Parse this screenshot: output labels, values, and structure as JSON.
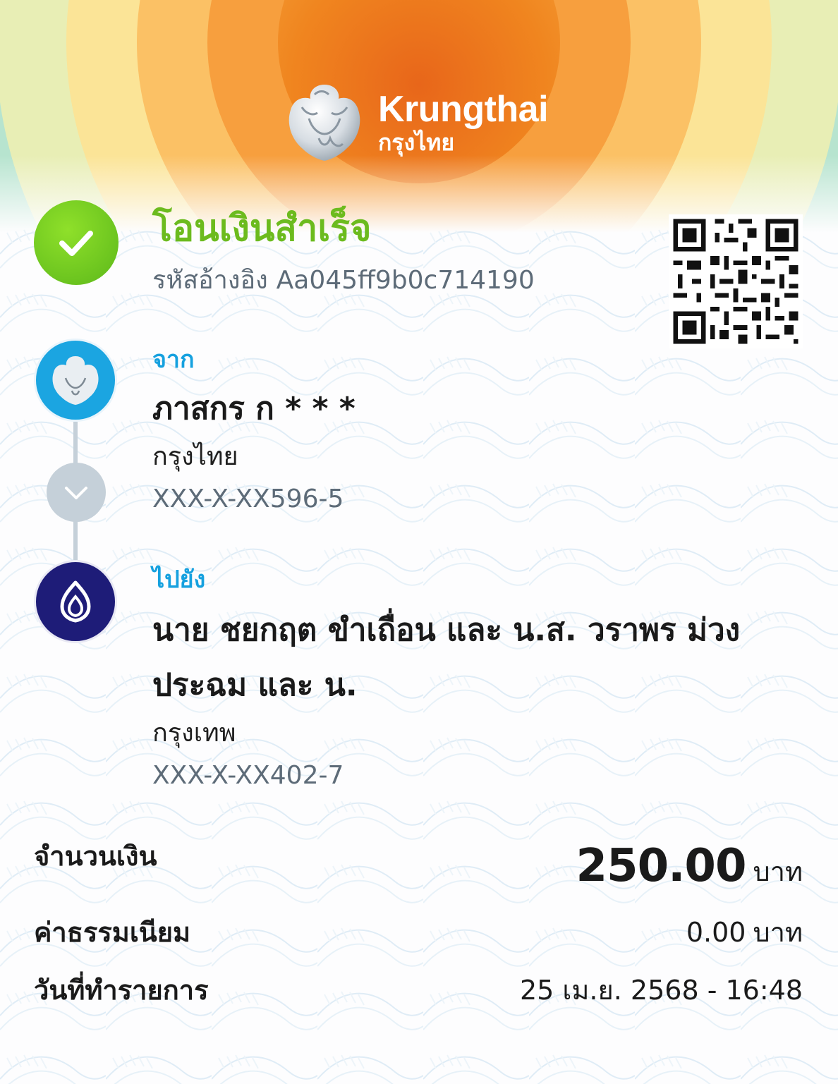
{
  "brand": {
    "name_en": "Krungthai",
    "name_th": "กรุงไทย"
  },
  "status": {
    "title": "โอนเงินสำเร็จ",
    "ref_label": "รหัสอ้างอิง",
    "ref_code": "Aa045ff9b0c714190"
  },
  "from": {
    "label": "จาก",
    "name": "ภาสกร ก * * *",
    "bank": "กรุงไทย",
    "account": "XXX-X-XX596-5"
  },
  "to": {
    "label": "ไปยัง",
    "name_line1": "นาย ชยกฤต ขำเถื่อน และ น.ส. วราพร ม่วง",
    "name_line2": "ประฉม และ น.",
    "bank": "กรุงเทพ",
    "account": "XXX-X-XX402-7"
  },
  "details": {
    "amount": {
      "label": "จำนวนเงิน",
      "value": "250.00",
      "unit": "บาท"
    },
    "fee": {
      "label": "ค่าธรรมเนียม",
      "value": "0.00",
      "unit": "บาท"
    },
    "date": {
      "label": "วันที่ทำรายการ",
      "value": "25 เม.ย. 2568 - 16:48"
    }
  },
  "colors": {
    "success": "#6cbb1e",
    "accent_blue": "#16a1df",
    "krungthai_blue": "#1ba5e1",
    "bbl_navy": "#1e1c78"
  },
  "icons": {
    "status": "check-icon",
    "from_bank": "krungthai-bird-logo",
    "to_bank": "bangkok-bank-lotus-logo",
    "flow": "chevron-down-icon"
  }
}
